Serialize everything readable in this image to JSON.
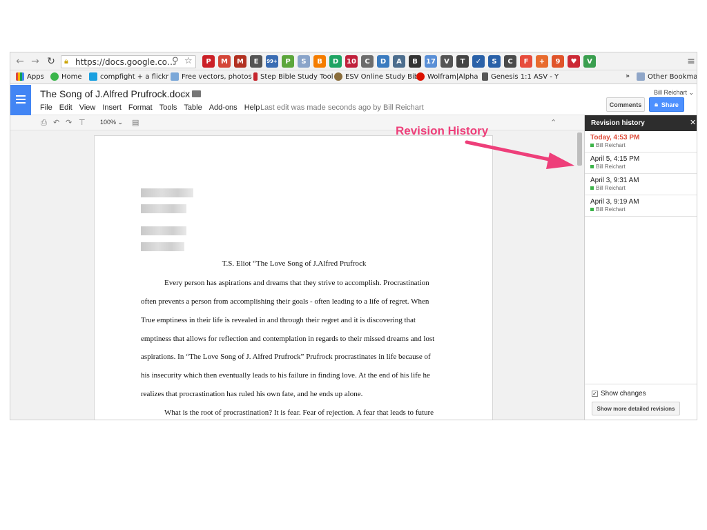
{
  "browser": {
    "url": "https://docs.google.co…",
    "extensions": [
      {
        "name": "pinterest-icon",
        "glyph": "P",
        "color": "#cb2027"
      },
      {
        "name": "gmail-icon",
        "glyph": "M",
        "color": "#d44638"
      },
      {
        "name": "gmail-alt-icon",
        "glyph": "M",
        "color": "#b23121"
      },
      {
        "name": "evernote-icon",
        "glyph": "E",
        "color": "#555555"
      },
      {
        "name": "badge-extension-icon",
        "glyph": "99+",
        "color": "#3b6db3"
      },
      {
        "name": "print-friendly-icon",
        "glyph": "P",
        "color": "#5ca63b"
      },
      {
        "name": "search-ext-icon",
        "glyph": "S",
        "color": "#8aa4c9"
      },
      {
        "name": "blogger-icon",
        "glyph": "B",
        "color": "#f57d00"
      },
      {
        "name": "drive-icon",
        "glyph": "D",
        "color": "#1fa463"
      },
      {
        "name": "badge-10-icon",
        "glyph": "10",
        "color": "#c0203b"
      },
      {
        "name": "clip-icon",
        "glyph": "C",
        "color": "#6d6d6d"
      },
      {
        "name": "doc-ext-icon",
        "glyph": "D",
        "color": "#3b7bbf"
      },
      {
        "name": "avatar-ext-icon",
        "glyph": "A",
        "color": "#4d6e8e"
      },
      {
        "name": "buffer-icon",
        "glyph": "B",
        "color": "#333333"
      },
      {
        "name": "calendar-icon",
        "glyph": "17",
        "color": "#5a8fd6"
      },
      {
        "name": "pocket-icon",
        "glyph": "V",
        "color": "#555555"
      },
      {
        "name": "tag-icon",
        "glyph": "T",
        "color": "#444444"
      },
      {
        "name": "check-icon",
        "glyph": "✓",
        "color": "#2a61a8"
      },
      {
        "name": "screen-icon",
        "glyph": "S",
        "color": "#2a61a8"
      },
      {
        "name": "camera-icon",
        "glyph": "C",
        "color": "#4a4a4a"
      },
      {
        "name": "feedly-icon",
        "glyph": "F",
        "color": "#e74c3c"
      },
      {
        "name": "plus-icon",
        "glyph": "+",
        "color": "#e86b2e"
      },
      {
        "name": "gear-badge-icon",
        "glyph": "9",
        "color": "#e0542a"
      },
      {
        "name": "heart-icon",
        "glyph": "♥",
        "color": "#cc2a36"
      },
      {
        "name": "v-icon",
        "glyph": "V",
        "color": "#3a9f4f"
      }
    ]
  },
  "bookmarks": {
    "apps": "Apps",
    "home": "Home",
    "compfight": "compfight + a flickr",
    "free_vectors": "Free vectors, photos",
    "step_bible": "Step Bible Study Tool",
    "esv": "ESV Online Study Bib",
    "wolfram": "Wolfram|Alpha",
    "genesis": "Genesis 1:1 ASV - Y",
    "more": "»",
    "other": "Other Bookmarks"
  },
  "docs": {
    "title": "The Song of J.Alfred Prufrock.docx",
    "menu": [
      "File",
      "Edit",
      "View",
      "Insert",
      "Format",
      "Tools",
      "Table",
      "Add-ons",
      "Help"
    ],
    "last_edit": "Last edit was made seconds ago by Bill Reichart",
    "user": "Bill Reichart",
    "comments": "Comments",
    "share": "Share",
    "zoom": "100%"
  },
  "document": {
    "essay_title": "T.S. Eliot “The Love Song of J.Alfred Prufrock",
    "lines": [
      "Every person has aspirations and dreams that they strive to accomplish. Procrastination",
      "often prevents a person from accomplishing their goals - often leading to a life of regret. When",
      "True emptiness in their life is revealed in and through their regret and it is discovering that",
      "emptiness that allows for reflection and contemplation in regards to their missed dreams and lost",
      "aspirations.  In “The Love Song of J. Alfred Prufrock” Prufrock procrastinates in life because of",
      "his insecurity which then eventually leads to his failure in finding love. At the end of his life he",
      "realizes that procrastination has ruled his own fate, and he ends up alone.",
      "What is the root of procrastination? It is fear. Fear of rejection. A fear that leads to future"
    ]
  },
  "revisions": {
    "header": "Revision history",
    "items": [
      {
        "date": "Today, 4:53 PM",
        "author": "Bill Reichart"
      },
      {
        "date": "April 5, 4:15 PM",
        "author": "Bill Reichart"
      },
      {
        "date": "April 3, 9:31 AM",
        "author": "Bill Reichart"
      },
      {
        "date": "April 3, 9:19 AM",
        "author": "Bill Reichart"
      }
    ],
    "show_changes": "Show changes",
    "more_detailed": "Show more detailed revisions"
  },
  "annotation": {
    "label": "Revision History",
    "color": "#ee3f7a"
  }
}
